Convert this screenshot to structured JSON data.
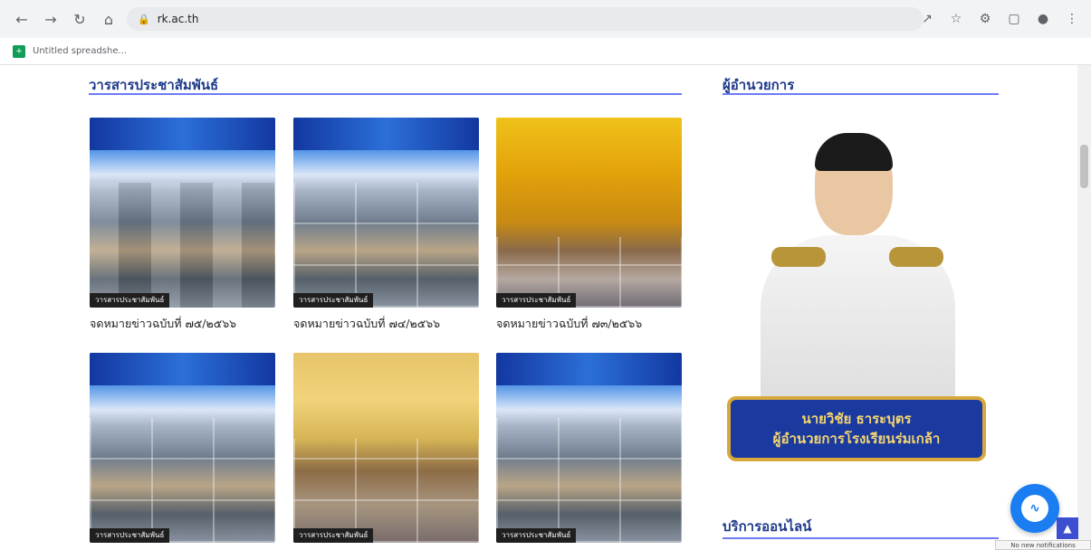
{
  "browser": {
    "url": "rk.ac.th",
    "bookmark_label": "Untitled spreadshe..."
  },
  "news": {
    "heading": "วารสารประชาสัมพันธ์",
    "items": [
      {
        "caption": "จดหมายข่าวฉบับที่ ๗๕/๒๕๖๖",
        "badge": "วารสารประชาสัมพันธ์",
        "style": "blue"
      },
      {
        "caption": "จดหมายข่าวฉบับที่ ๗๔/๒๕๖๖",
        "badge": "วารสารประชาสัมพันธ์",
        "style": "blue"
      },
      {
        "caption": "จดหมายข่าวฉบับที่ ๗๓/๒๕๖๖",
        "badge": "วารสารประชาสัมพันธ์",
        "style": "gold"
      },
      {
        "caption": "",
        "badge": "วารสารประชาสัมพันธ์",
        "style": "blue"
      },
      {
        "caption": "",
        "badge": "วารสารประชาสัมพันธ์",
        "style": "gold2"
      },
      {
        "caption": "",
        "badge": "วารสารประชาสัมพันธ์",
        "style": "blue"
      }
    ]
  },
  "director": {
    "heading": "ผู้อำนวยการ",
    "name": "นายวิชัย ธาระบุตร",
    "position": "ผู้อำนวยการโรงเรียนร่มเกล้า"
  },
  "online_services": {
    "heading": "บริการออนไลน์"
  },
  "notification": "No new notifications",
  "colors": {
    "heading": "#1e3a8a",
    "underline": "#6b7cf5",
    "messenger": "#1a7df2"
  }
}
